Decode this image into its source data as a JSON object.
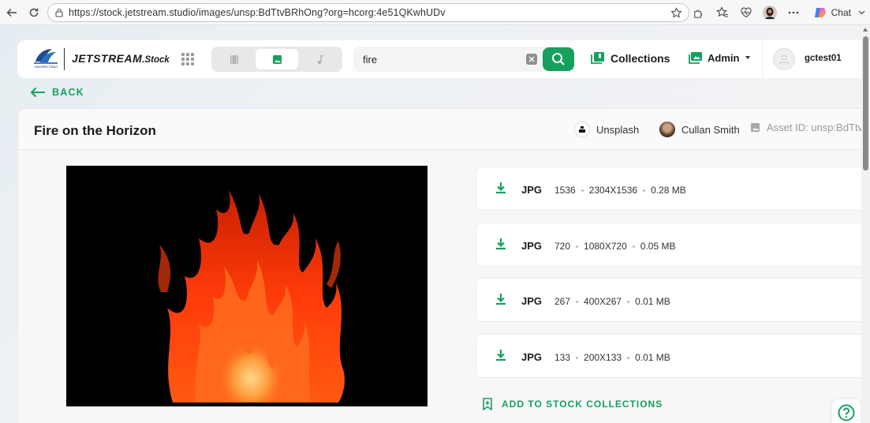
{
  "browser": {
    "url": "https://stock.jetstream.studio/images/unsp:BdTtvBRhOng?org=hcorg:4e51QKwhUDv",
    "chat_label": "Chat"
  },
  "header": {
    "brand_main": "JETSTREAM",
    "brand_sub": ".Stock",
    "logo_caption": "Adventist Cloud",
    "search_value": "fire",
    "collections_label": "Collections",
    "admin_label": "Admin",
    "username": "gctest01"
  },
  "back_label": "BACK",
  "asset": {
    "title": "Fire on the Horizon",
    "source": "Unsplash",
    "author": "Cullan Smith",
    "asset_id": "Asset ID: unsp:BdTtvBRhOng"
  },
  "downloads": [
    {
      "format": "JPG",
      "size": "1536",
      "dims": "2304X1536",
      "file": "0.28 MB"
    },
    {
      "format": "JPG",
      "size": "720",
      "dims": "1080X720",
      "file": "0.05 MB"
    },
    {
      "format": "JPG",
      "size": "267",
      "dims": "400X267",
      "file": "0.01 MB"
    },
    {
      "format": "JPG",
      "size": "133",
      "dims": "200X133",
      "file": "0.01 MB"
    }
  ],
  "add_collections_label": "ADD TO STOCK COLLECTIONS",
  "colors": {
    "accent": "#17a05d",
    "text": "#1b1b1b"
  },
  "icons": [
    "back-arrow-icon",
    "refresh-icon",
    "lock-icon",
    "star-icon",
    "extensions-icon",
    "favorites-icon",
    "health-icon",
    "more-icon",
    "grid-icon",
    "video-icon",
    "image-icon",
    "music-icon",
    "clear-icon",
    "search-icon",
    "collections-icon",
    "admin-icon",
    "download-icon",
    "bookmark-add-icon",
    "help-icon"
  ]
}
